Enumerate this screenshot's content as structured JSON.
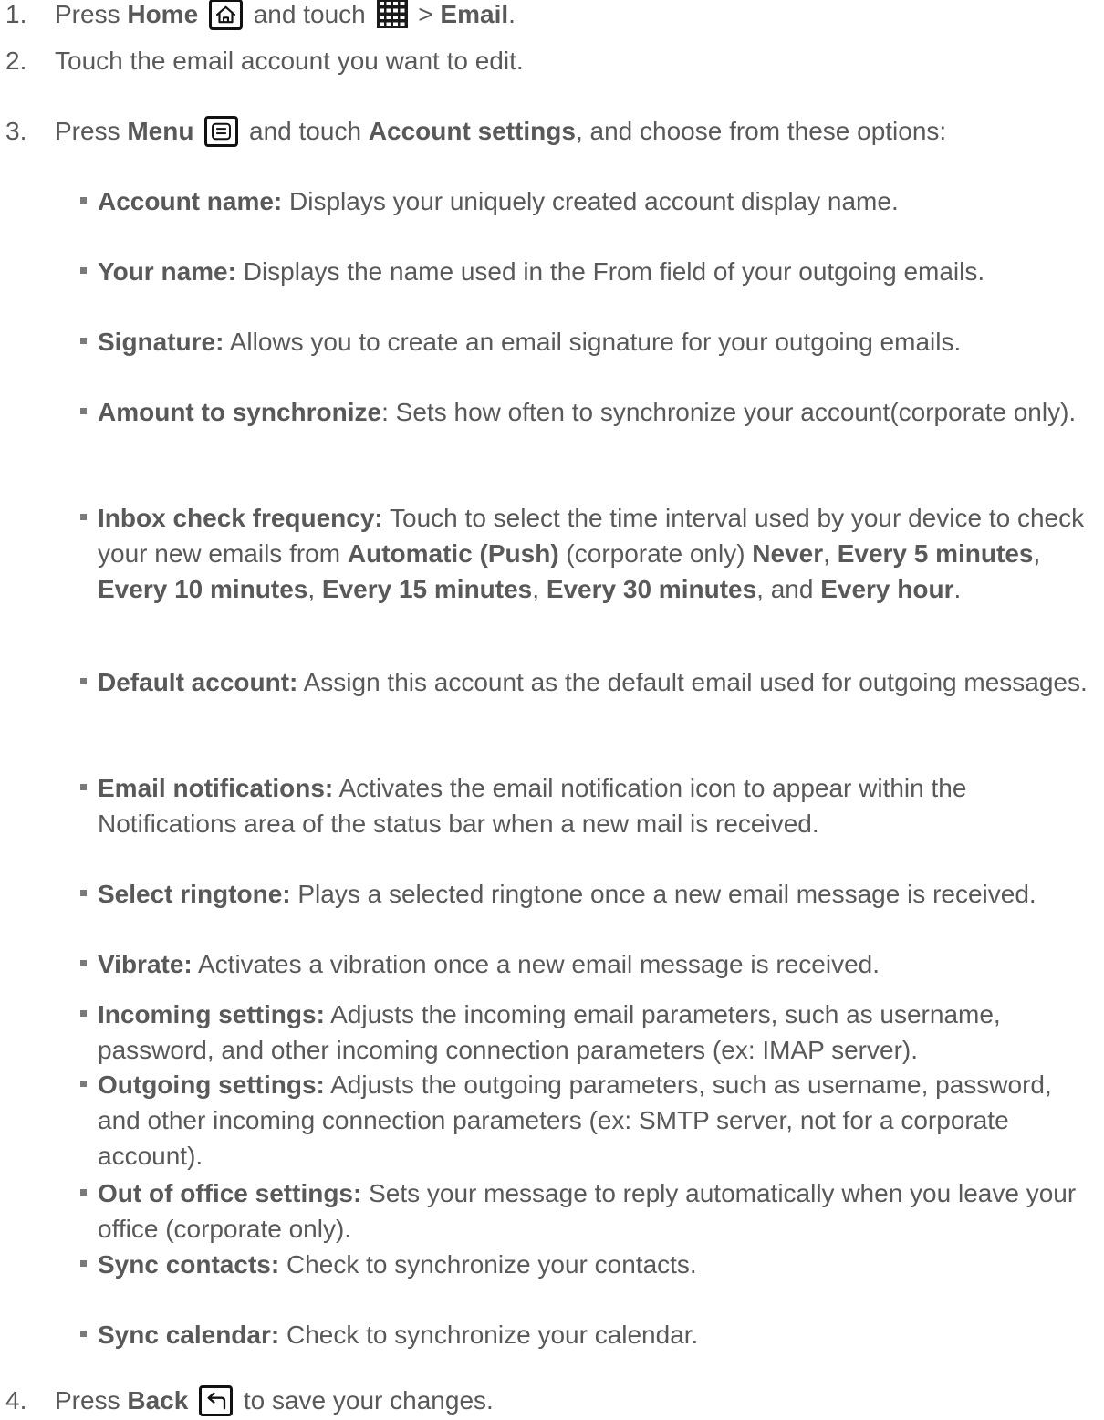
{
  "steps": [
    {
      "num": "1.",
      "parts": {
        "a": "Press ",
        "b": "Home",
        "c": " and touch ",
        "d": " > ",
        "e": "Email",
        "f": "."
      }
    },
    {
      "num": "2.",
      "text": "Touch the email account you want to edit."
    },
    {
      "num": "3.",
      "parts": {
        "a": "Press ",
        "b": "Menu",
        "c": " and touch ",
        "d": "Account settings",
        "e": ", and choose from these options:"
      }
    },
    {
      "num": "4.",
      "parts": {
        "a": "Press ",
        "b": "Back",
        "c": " to save your changes."
      }
    }
  ],
  "options": [
    {
      "term": "Account name:",
      "desc": " Displays your uniquely created account display name."
    },
    {
      "term": "Your name:",
      "desc": " Displays the name used in the From field of your outgoing emails."
    },
    {
      "term": "Signature:",
      "desc": " Allows you to create an email signature for your outgoing emails."
    },
    {
      "term": "Amount to synchronize",
      "desc": ": Sets how often to synchronize your account(corporate only)."
    },
    {
      "term": "Inbox check frequency:",
      "desc": " Touch to select the time interval used by your device to check your new emails from ",
      "automatic": "Automatic (Push)",
      "corp": " (corporate only) ",
      "never": "Never",
      "sep": ", ",
      "e5": "Every 5 minutes",
      "e10": "Every 10 minutes",
      "e15": "Every 15 minutes",
      "e30": "Every 30 minutes",
      "and": ", and ",
      "ehour": "Every hour",
      "end": "."
    },
    {
      "term": "Default account:",
      "desc": " Assign this account as the default email used for outgoing messages."
    },
    {
      "term": "Email notifications:",
      "desc": " Activates the email notification icon to appear within the Notifications area of the status bar when a new mail is received."
    },
    {
      "term": "Select ringtone:",
      "desc": " Plays a selected ringtone once a new email message is received."
    },
    {
      "term": "Vibrate:",
      "desc": " Activates a vibration once a new email message is received."
    },
    {
      "term": "Incoming settings:",
      "desc": " Adjusts the incoming email parameters, such as username, password, and other incoming connection parameters (ex: IMAP server)."
    },
    {
      "term": "Outgoing settings:",
      "desc": " Adjusts the outgoing parameters, such as username, password, and other incoming connection parameters (ex: SMTP server, not for a corporate account)."
    },
    {
      "term": "Out of office settings:",
      "desc": " Sets your message to reply automatically when you leave your office (corporate only)."
    },
    {
      "term": "Sync contacts:",
      "desc": " Check to synchronize your contacts."
    },
    {
      "term": "Sync calendar:",
      "desc": " Check to synchronize your calendar."
    }
  ],
  "icons": {
    "home": "home-icon",
    "apps": "apps-grid-icon",
    "menu": "menu-icon",
    "back": "back-icon"
  }
}
